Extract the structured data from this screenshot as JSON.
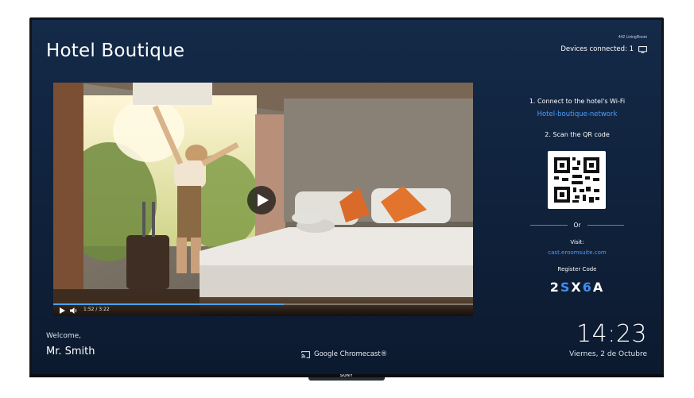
{
  "header": {
    "title": "Hotel Boutique",
    "room_label": "442 LivingRoom",
    "devices_connected": "Devices connected: 1",
    "devices_icon": "monitor-icon"
  },
  "video": {
    "play_icon": "play-icon",
    "time": "1:52 / 3:22",
    "progress": 0.55,
    "progress_color": "#4aa3ff"
  },
  "instructions": {
    "step1": "1. Connect to the hotel's Wi-Fi",
    "wifi_name": "Hotel-boutique-network",
    "step2": "2. Scan the QR code",
    "or": "Or",
    "visit_label": "Visit:",
    "visit_url": "cast.eroomsuite.com",
    "register_label": "Register Code",
    "register_code": [
      "2",
      "S",
      "X",
      "6",
      "A"
    ],
    "register_code_highlight": [
      false,
      true,
      false,
      true,
      false
    ]
  },
  "footer": {
    "welcome": "Welcome,",
    "guest_name": "Mr. Smith",
    "chromecast": "Google Chromecast®",
    "time": "14:23",
    "date": "Viernes, 2 de Octubre"
  },
  "tv": {
    "brand": "SONY"
  },
  "colors": {
    "background": "#10223c",
    "accent_link": "#4d9cff",
    "code_highlight": "#3f8df0"
  }
}
